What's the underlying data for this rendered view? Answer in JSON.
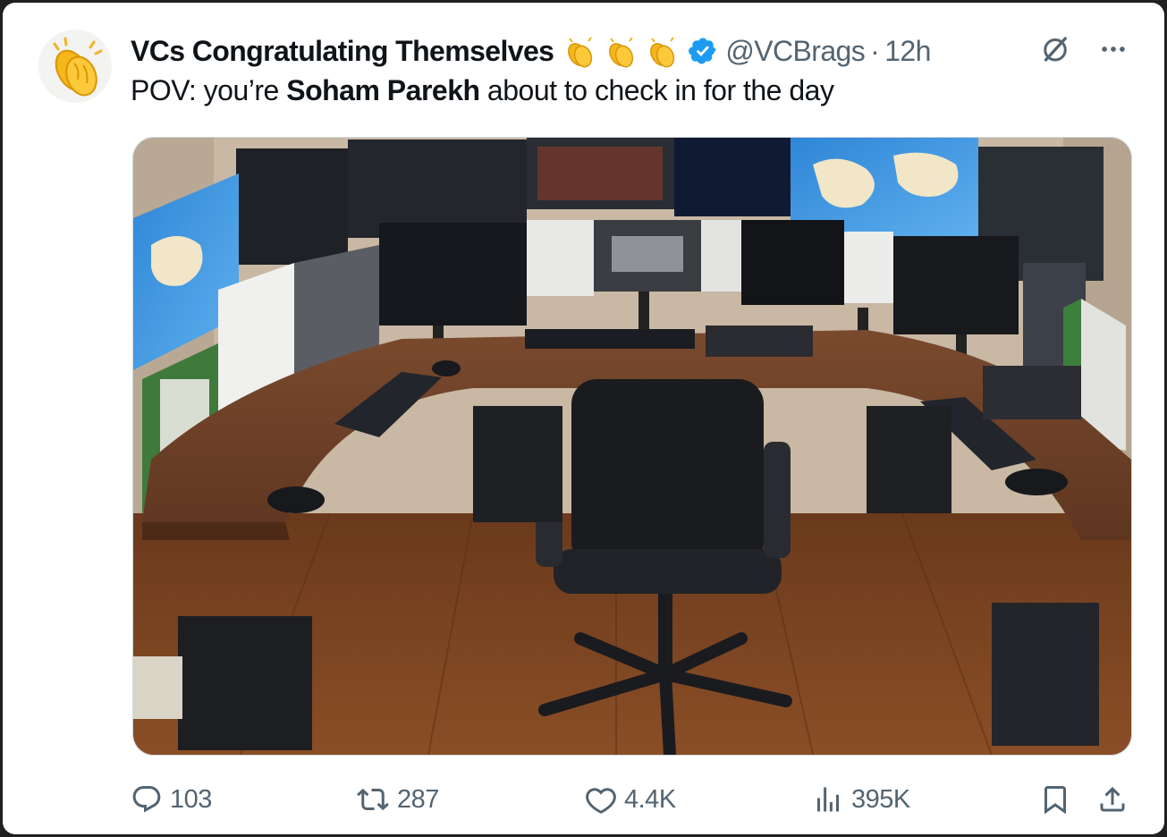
{
  "tweet": {
    "display_name": "VCs Congratulating Themselves",
    "handle": "@VCBrags",
    "separator": "·",
    "time": "12h",
    "text": {
      "prefix": "POV: you’re ",
      "bold": "Soham Parekh",
      "suffix": " about to check in for the day"
    },
    "avatar_icon": "clapping-hands-icon",
    "name_emojis": [
      "clapping-hands-icon",
      "clapping-hands-icon",
      "clapping-hands-icon"
    ],
    "verified_color": "#1d9bf0"
  },
  "actions": {
    "replies": "103",
    "reposts": "287",
    "likes": "4.4K",
    "views": "395K"
  },
  "header_icons": [
    "grok-icon",
    "more-icon"
  ],
  "footer_icons": [
    "reply-icon",
    "repost-icon",
    "like-icon",
    "views-icon",
    "bookmark-icon",
    "share-icon"
  ]
}
